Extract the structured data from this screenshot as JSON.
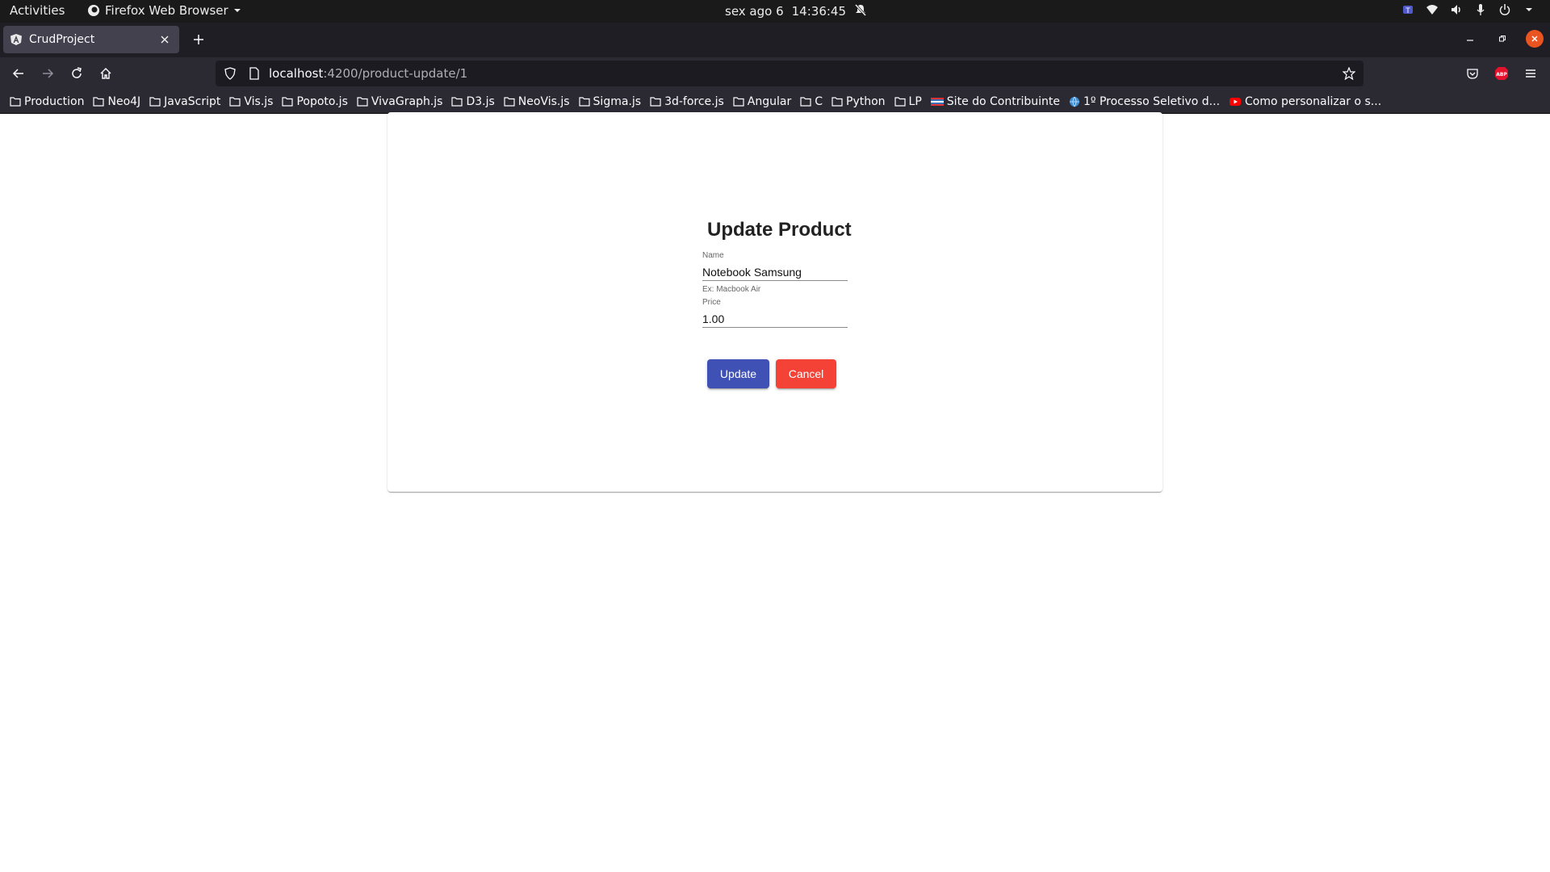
{
  "system": {
    "activities": "Activities",
    "app_name": "Firefox Web Browser",
    "clock_date": "sex ago 6",
    "clock_time": "14:36:45"
  },
  "browser": {
    "tab_title": "CrudProject",
    "url_host": "localhost",
    "url_path": ":4200/product-update/1"
  },
  "bookmarks": [
    {
      "label": "Production",
      "icon": "folder-icon"
    },
    {
      "label": "Neo4J",
      "icon": "folder-icon"
    },
    {
      "label": "JavaScript",
      "icon": "folder-icon"
    },
    {
      "label": "Vis.js",
      "icon": "folder-icon"
    },
    {
      "label": "Popoto.js",
      "icon": "folder-icon"
    },
    {
      "label": "VivaGraph.js",
      "icon": "folder-icon"
    },
    {
      "label": "D3.js",
      "icon": "folder-icon"
    },
    {
      "label": "NeoVis.js",
      "icon": "folder-icon"
    },
    {
      "label": "Sigma.js",
      "icon": "folder-icon"
    },
    {
      "label": "3d-force.js",
      "icon": "folder-icon"
    },
    {
      "label": "Angular",
      "icon": "folder-icon"
    },
    {
      "label": "C",
      "icon": "folder-icon"
    },
    {
      "label": "Python",
      "icon": "folder-icon"
    },
    {
      "label": "LP",
      "icon": "folder-icon"
    },
    {
      "label": "Site do Contribuinte",
      "icon": "flag-icon"
    },
    {
      "label": "1º Processo Seletivo d...",
      "icon": "globe-icon"
    },
    {
      "label": "Como personalizar o s...",
      "icon": "youtube-icon"
    }
  ],
  "form": {
    "title": "Update Product",
    "name_label": "Name",
    "name_value": "Notebook Samsung",
    "name_hint": "Ex: Macbook Air",
    "price_label": "Price",
    "price_value": "1.00",
    "update_label": "Update",
    "cancel_label": "Cancel"
  },
  "colors": {
    "primary": "#3f51b5",
    "warn": "#f44336",
    "ubuntu_orange": "#e95420"
  }
}
